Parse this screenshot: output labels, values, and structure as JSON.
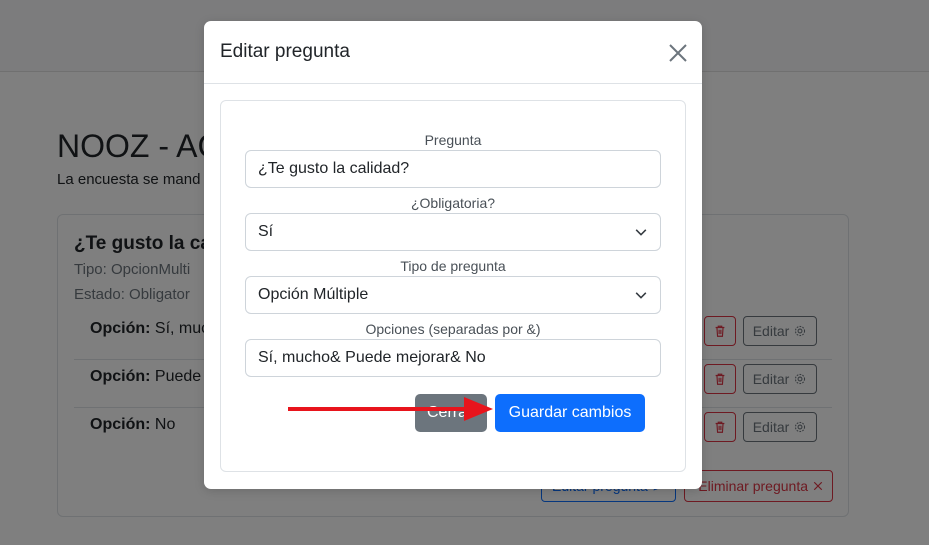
{
  "background": {
    "page_title": "NOOZ - AC",
    "page_subtitle": "La encuesta se mand",
    "question_card": {
      "title": "¿Te gusto la ca",
      "type_text": "Tipo: OpcionMulti",
      "state_text": "Estado: Obligator",
      "options": [
        {
          "prefix": "Opción:",
          "value": "Sí, muc"
        },
        {
          "prefix": "Opción:",
          "value": "Puede"
        },
        {
          "prefix": "Opción:",
          "value": "No"
        }
      ],
      "edit_option_label": "Editar",
      "edit_question_label": "Editar pregunta",
      "delete_question_label": "Eliminar pregunta"
    }
  },
  "modal": {
    "title": "Editar pregunta",
    "fields": {
      "pregunta": {
        "label": "Pregunta",
        "value": "¿Te gusto la calidad?"
      },
      "obligatoria": {
        "label": "¿Obligatoria?",
        "value": "Sí"
      },
      "tipo": {
        "label": "Tipo de pregunta",
        "value": "Opción Múltiple"
      },
      "opciones": {
        "label": "Opciones (separadas por &)",
        "value": "Sí, mucho& Puede mejorar& No"
      }
    },
    "close_button_label": "Cerrar",
    "save_button_label": "Guardar cambios"
  },
  "colors": {
    "primary": "#0d6efd",
    "danger": "#dc3545",
    "secondary": "#6c757d",
    "annotation_arrow": "#e8141c"
  },
  "icons": {
    "modal_close": "close-icon",
    "select_arrow": "chevron-down-icon",
    "trash": "trash-icon",
    "gear": "gear-icon"
  }
}
